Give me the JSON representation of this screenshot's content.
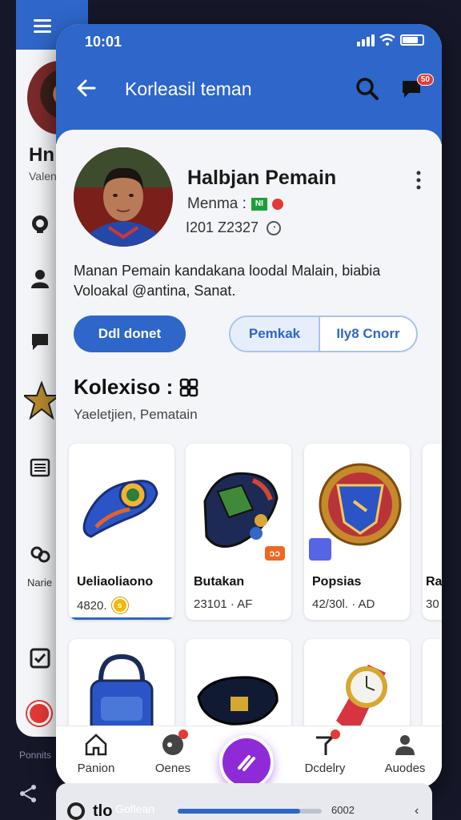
{
  "back_card": {
    "name": "Hn",
    "sub": "Valen",
    "label": "Narie",
    "bottom_label": "Ponnits"
  },
  "status_bar": {
    "time": "10:01"
  },
  "header": {
    "title": "Korleasil teman",
    "chat_badge": "50"
  },
  "profile": {
    "name": "Halbjan Pemain",
    "role": "Menma :",
    "flag": "NI",
    "id": "I201 Z2327",
    "bio": "Manan Pemain kandakana loodal Malain, biabia Voloakal @antina, Sanat."
  },
  "actions": {
    "primary": "Ddl donet",
    "seg_1": "Pemkak",
    "seg_2": "IIy8 Cnorr"
  },
  "collection": {
    "title": "Kolexiso :",
    "subtitle": "Yaeletjien, Pematain",
    "items": [
      {
        "name": "Ueliaoliaono",
        "meta": "4820.",
        "coin": "s"
      },
      {
        "name": "Butakan",
        "meta": "23101 · AF",
        "tag": "ɔɔ"
      },
      {
        "name": "Popsias",
        "meta": "42/30l. · AD"
      },
      {
        "name": "Ra",
        "meta": "30"
      }
    ]
  },
  "bottom_nav": {
    "items": [
      {
        "label": "Panion"
      },
      {
        "label": "Oenes"
      },
      {
        "label": "Dcdelry"
      },
      {
        "label": "Auodes"
      }
    ]
  },
  "media_bar": {
    "prefix": "tlo",
    "label": "Goflean",
    "time": "6002",
    "progress": 0.85
  },
  "colors": {
    "primary": "#2e66c9",
    "fab": "#8e2bd6",
    "badge": "#e53935"
  }
}
